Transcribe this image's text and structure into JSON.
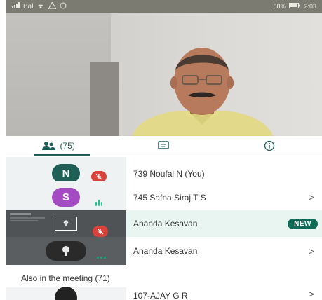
{
  "status_bar": {
    "left_icons": [
      "signal-icon",
      "wifi-icon",
      "warning-icon",
      "call-icon"
    ],
    "left_text": "Bal",
    "right_text": "88%",
    "time": "2:03"
  },
  "tabs": [
    {
      "name": "participants",
      "label": "(75)",
      "icon": "people-icon",
      "active": true
    },
    {
      "name": "chat",
      "label": "",
      "icon": "chat-icon",
      "active": false
    },
    {
      "name": "info",
      "label": "",
      "icon": "info-icon",
      "active": false
    }
  ],
  "participants": [
    {
      "initial": "N",
      "avatar_color": "#1f5f55",
      "name": "739 Noufal N (You)",
      "muted": true,
      "speaking": false,
      "chevron": ""
    },
    {
      "initial": "S",
      "avatar_color": "#a44ac2",
      "name": "745 Safna Siraj T S",
      "muted": false,
      "speaking": true,
      "chevron": ">"
    },
    {
      "initial": "",
      "avatar_color": "",
      "name": "Ananda Kesavan",
      "muted": true,
      "speaking": false,
      "badge": "NEW",
      "chevron": ""
    },
    {
      "initial": "",
      "avatar_color": "",
      "name": "Ananda Kesavan",
      "muted": false,
      "speaking": true,
      "chevron": ">"
    }
  ],
  "section_also": "Also in the meeting (71)",
  "other_participant": {
    "name": "107-AJAY G R",
    "chevron": ">"
  }
}
